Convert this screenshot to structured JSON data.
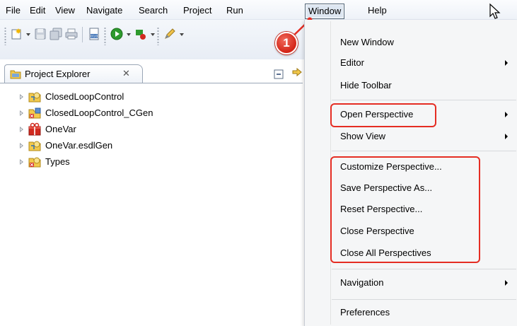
{
  "menubar": {
    "items": [
      "File",
      "Edit",
      "View",
      "Navigate",
      "Search",
      "Project",
      "Run",
      "Window",
      "Help"
    ],
    "active": "Window"
  },
  "annotation": {
    "step": "1",
    "color": "#e52d23"
  },
  "explorer": {
    "tab_label": "Project Explorer",
    "close_glyph": "✕",
    "items": [
      {
        "label": "ClosedLoopControl",
        "icon": "project-ref-icon"
      },
      {
        "label": "ClosedLoopControl_CGen",
        "icon": "project-gen-icon"
      },
      {
        "label": "OneVar",
        "icon": "project-gift-icon"
      },
      {
        "label": "OneVar.esdlGen",
        "icon": "project-ref-icon"
      },
      {
        "label": "Types",
        "icon": "project-ref-error-icon"
      }
    ]
  },
  "window_menu": {
    "items": [
      {
        "label": "New Window",
        "submenu": false
      },
      {
        "label": "Editor",
        "submenu": true
      },
      {
        "label": "Hide Toolbar",
        "submenu": false
      },
      {
        "label": "Open Perspective",
        "submenu": true
      },
      {
        "label": "Show View",
        "submenu": true
      },
      {
        "label": "Customize Perspective...",
        "submenu": false
      },
      {
        "label": "Save Perspective As...",
        "submenu": false
      },
      {
        "label": "Reset Perspective...",
        "submenu": false
      },
      {
        "label": "Close Perspective",
        "submenu": false
      },
      {
        "label": "Close All Perspectives",
        "submenu": false
      },
      {
        "label": "Navigation",
        "submenu": true
      },
      {
        "label": "Preferences",
        "submenu": false
      }
    ]
  }
}
